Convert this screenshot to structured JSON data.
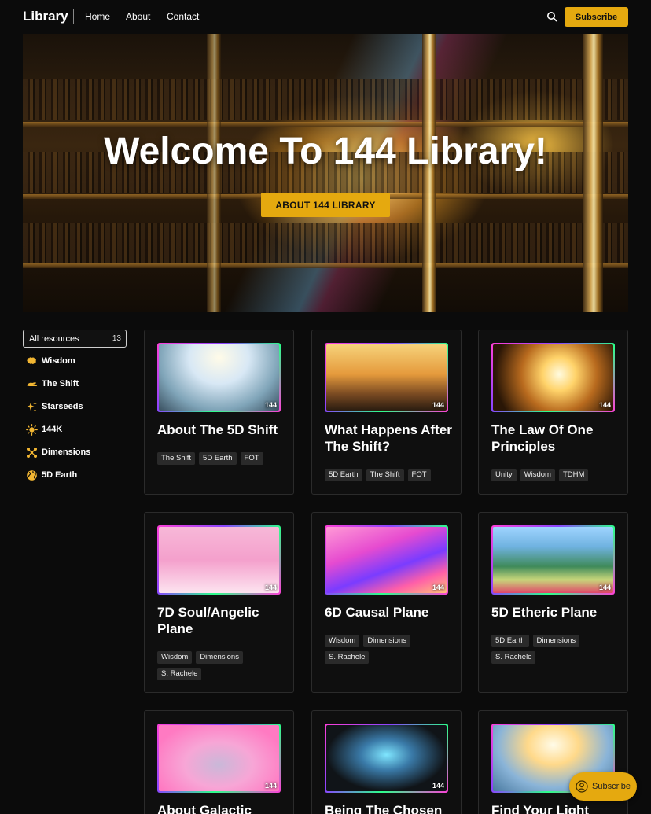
{
  "header": {
    "brand": "Library",
    "nav": [
      "Home",
      "About",
      "Contact"
    ],
    "subscribe_label": "Subscribe"
  },
  "hero": {
    "title": "Welcome To 144 Library!",
    "button_label": "ABOUT 144 LIBRARY"
  },
  "sidebar": {
    "all_label": "All resources",
    "all_count": "13",
    "categories": [
      {
        "label": "Wisdom",
        "icon": "brain-icon"
      },
      {
        "label": "The Shift",
        "icon": "hands-icon"
      },
      {
        "label": "Starseeds",
        "icon": "sparkles-icon"
      },
      {
        "label": "144K",
        "icon": "sun-icon"
      },
      {
        "label": "Dimensions",
        "icon": "network-icon"
      },
      {
        "label": "5D Earth",
        "icon": "globe-icon"
      }
    ]
  },
  "thumb_badge": "144",
  "cards": [
    {
      "title": "About The 5D Shift",
      "tags": [
        "The Shift",
        "5D Earth",
        "FOT"
      ]
    },
    {
      "title": "What Happens After The Shift?",
      "tags": [
        "5D Earth",
        "The Shift",
        "FOT"
      ]
    },
    {
      "title": "The Law Of One Principles",
      "tags": [
        "Unity",
        "Wisdom",
        "TDHM"
      ]
    },
    {
      "title": "7D Soul/Angelic Plane",
      "tags": [
        "Wisdom",
        "Dimensions",
        "S. Rachele"
      ]
    },
    {
      "title": "6D Causal Plane",
      "tags": [
        "Wisdom",
        "Dimensions",
        "S. Rachele"
      ]
    },
    {
      "title": "5D Etheric Plane",
      "tags": [
        "5D Earth",
        "Dimensions",
        "S. Rachele"
      ]
    },
    {
      "title": "About Galactic",
      "tags": []
    },
    {
      "title": "Being The Chosen",
      "tags": []
    },
    {
      "title": "Find Your Light",
      "tags": []
    }
  ],
  "float_subscribe_label": "Subscribe",
  "colors": {
    "accent": "#e5a90f",
    "background": "#0b0b0b",
    "tag_bg": "#2a2a2a"
  }
}
